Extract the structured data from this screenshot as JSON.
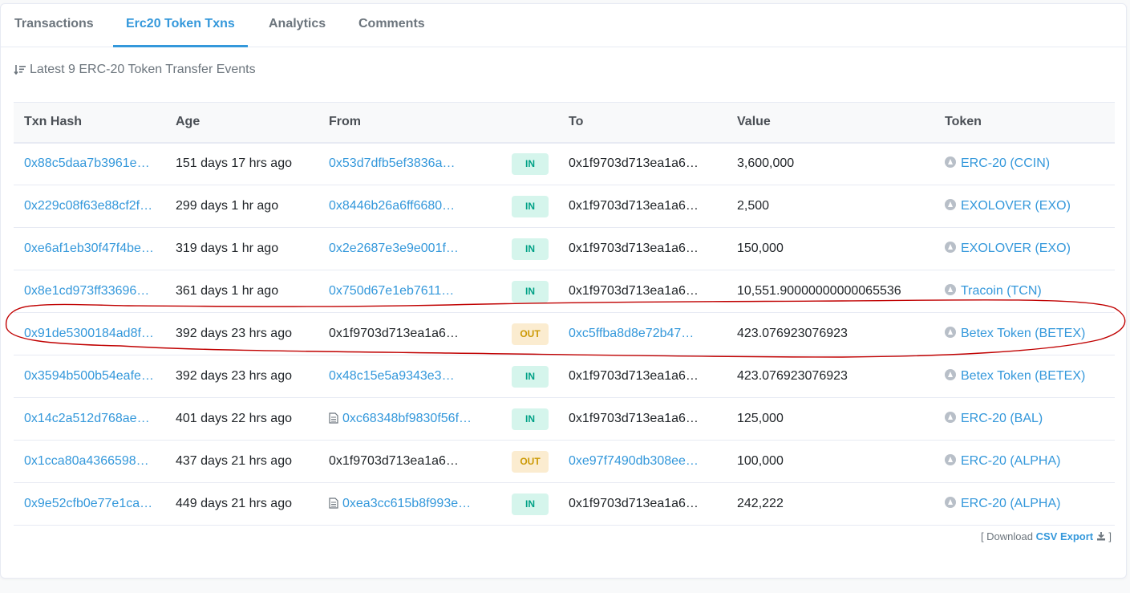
{
  "tabs": [
    {
      "label": "Transactions"
    },
    {
      "label": "Erc20 Token Txns"
    },
    {
      "label": "Analytics"
    },
    {
      "label": "Comments"
    }
  ],
  "summary": "Latest 9 ERC-20 Token Transfer Events",
  "columns": {
    "hash": "Txn Hash",
    "age": "Age",
    "from": "From",
    "to": "To",
    "value": "Value",
    "token": "Token"
  },
  "rows": [
    {
      "hash": "0x88c5daa7b3961e…",
      "age": "151 days 17 hrs ago",
      "from": "0x53d7dfb5ef3836a…",
      "from_link": true,
      "from_contract": false,
      "dir": "IN",
      "to": "0x1f9703d713ea1a6…",
      "to_link": false,
      "value": "3,600,000",
      "token": "ERC-20 (CCIN)"
    },
    {
      "hash": "0x229c08f63e88cf2f…",
      "age": "299 days 1 hr ago",
      "from": "0x8446b26a6ff6680…",
      "from_link": true,
      "from_contract": false,
      "dir": "IN",
      "to": "0x1f9703d713ea1a6…",
      "to_link": false,
      "value": "2,500",
      "token": "EXOLOVER (EXO)"
    },
    {
      "hash": "0xe6af1eb30f47f4be…",
      "age": "319 days 1 hr ago",
      "from": "0x2e2687e3e9e001f…",
      "from_link": true,
      "from_contract": false,
      "dir": "IN",
      "to": "0x1f9703d713ea1a6…",
      "to_link": false,
      "value": "150,000",
      "token": "EXOLOVER (EXO)"
    },
    {
      "hash": "0x8e1cd973ff33696…",
      "age": "361 days 1 hr ago",
      "from": "0x750d67e1eb7611…",
      "from_link": true,
      "from_contract": false,
      "dir": "IN",
      "to": "0x1f9703d713ea1a6…",
      "to_link": false,
      "value": "10,551.90000000000065536",
      "token": "Tracoin (TCN)"
    },
    {
      "hash": "0x91de5300184ad8f…",
      "age": "392 days 23 hrs ago",
      "from": "0x1f9703d713ea1a6…",
      "from_link": false,
      "from_contract": false,
      "dir": "OUT",
      "to": "0xc5ffba8d8e72b47…",
      "to_link": true,
      "value": "423.076923076923",
      "token": "Betex Token (BETEX)"
    },
    {
      "hash": "0x3594b500b54eafe…",
      "age": "392 days 23 hrs ago",
      "from": "0x48c15e5a9343e3…",
      "from_link": true,
      "from_contract": false,
      "dir": "IN",
      "to": "0x1f9703d713ea1a6…",
      "to_link": false,
      "value": "423.076923076923",
      "token": "Betex Token (BETEX)"
    },
    {
      "hash": "0x14c2a512d768ae…",
      "age": "401 days 22 hrs ago",
      "from": "0xc68348bf9830f56f…",
      "from_link": true,
      "from_contract": true,
      "dir": "IN",
      "to": "0x1f9703d713ea1a6…",
      "to_link": false,
      "value": "125,000",
      "token": "ERC-20 (BAL)"
    },
    {
      "hash": "0x1cca80a4366598…",
      "age": "437 days 21 hrs ago",
      "from": "0x1f9703d713ea1a6…",
      "from_link": false,
      "from_contract": false,
      "dir": "OUT",
      "to": "0xe97f7490db308ee…",
      "to_link": true,
      "value": "100,000",
      "token": "ERC-20 (ALPHA)"
    },
    {
      "hash": "0x9e52cfb0e77e1ca…",
      "age": "449 days 21 hrs ago",
      "from": "0xea3cc615b8f993e…",
      "from_link": true,
      "from_contract": true,
      "dir": "IN",
      "to": "0x1f9703d713ea1a6…",
      "to_link": false,
      "value": "242,222",
      "token": "ERC-20 (ALPHA)"
    }
  ],
  "download": {
    "prefix": "[ Download",
    "link": "CSV Export",
    "suffix": "]"
  },
  "colors": {
    "link": "#3498db",
    "in_bg": "#d5f5ec",
    "in_text": "#00a186",
    "out_bg": "#fbecd0",
    "out_text": "#cc9a06",
    "annotation": "#c00000"
  }
}
